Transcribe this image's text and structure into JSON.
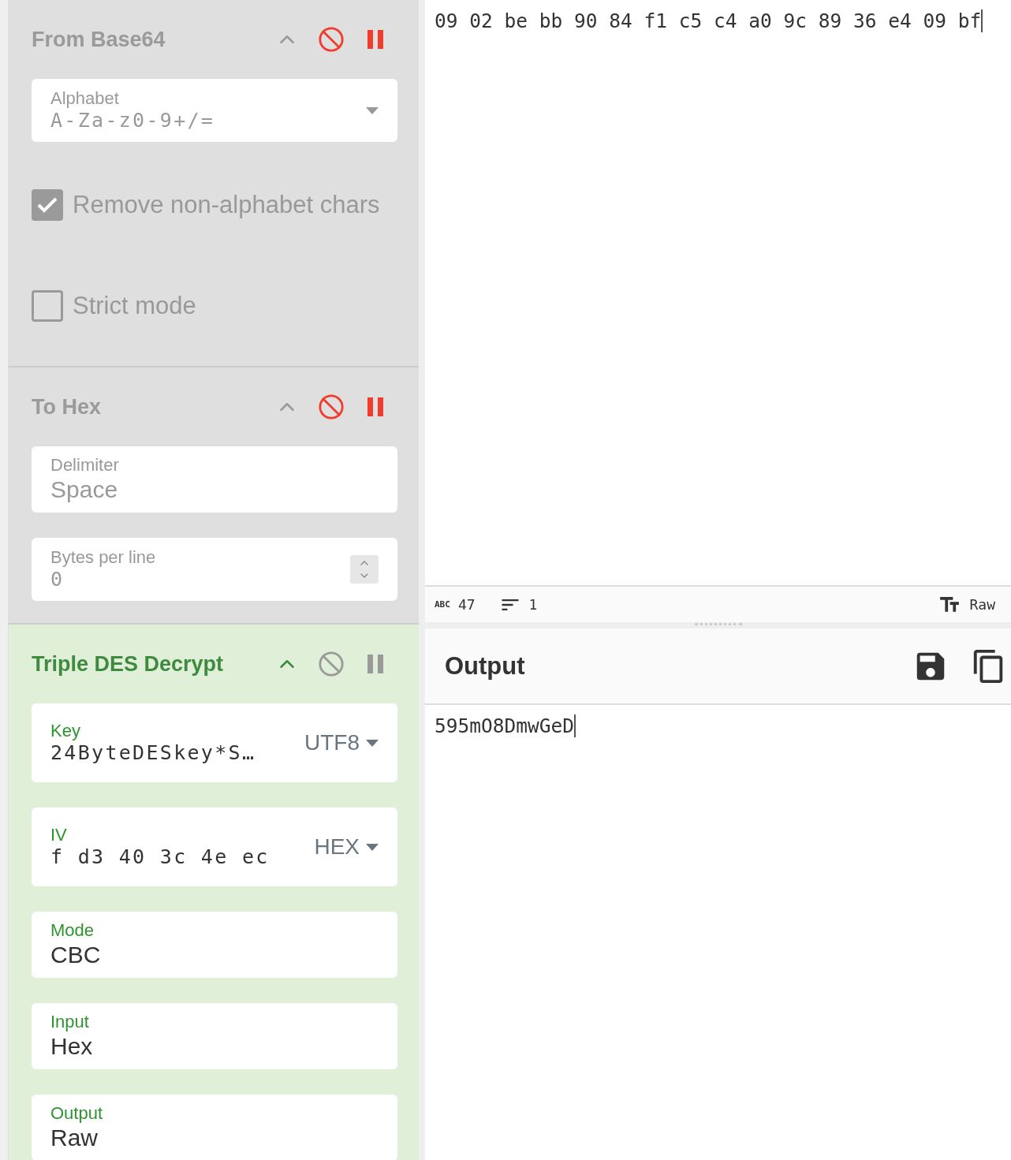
{
  "recipe": {
    "operations": [
      {
        "title": "From Base64",
        "disabled": true,
        "breakpoint": true,
        "args": [
          {
            "kind": "dropdown",
            "label": "Alphabet",
            "value": "A-Za-z0-9+/="
          },
          {
            "kind": "checkbox",
            "label": "Remove non-alphabet chars",
            "checked": true
          },
          {
            "kind": "checkbox",
            "label": "Strict mode",
            "checked": false
          }
        ]
      },
      {
        "title": "To Hex",
        "disabled": true,
        "breakpoint": true,
        "args": [
          {
            "kind": "option",
            "label": "Delimiter",
            "value": "Space"
          },
          {
            "kind": "number",
            "label": "Bytes per line",
            "value": "0"
          }
        ]
      },
      {
        "title": "Triple DES Decrypt",
        "disabled": false,
        "breakpoint": false,
        "args": [
          {
            "kind": "toggle",
            "label": "Key",
            "value": "24ByteDESkey*S…",
            "format": "UTF8"
          },
          {
            "kind": "toggle",
            "label": "IV",
            "value": "f d3 40 3c 4e ec",
            "format": "HEX"
          },
          {
            "kind": "option",
            "label": "Mode",
            "value": "CBC"
          },
          {
            "kind": "option",
            "label": "Input",
            "value": "Hex"
          },
          {
            "kind": "option",
            "label": "Output",
            "value": "Raw"
          }
        ]
      }
    ]
  },
  "input": {
    "length_label": "ABC",
    "text": "09 02 be bb 90 84 f1 c5 c4 a0 9c 89 36 e4 09 bf",
    "length": "47",
    "lines": "1",
    "format": "Raw"
  },
  "output": {
    "title": "Output",
    "text": "595mO8DmwGeD"
  }
}
